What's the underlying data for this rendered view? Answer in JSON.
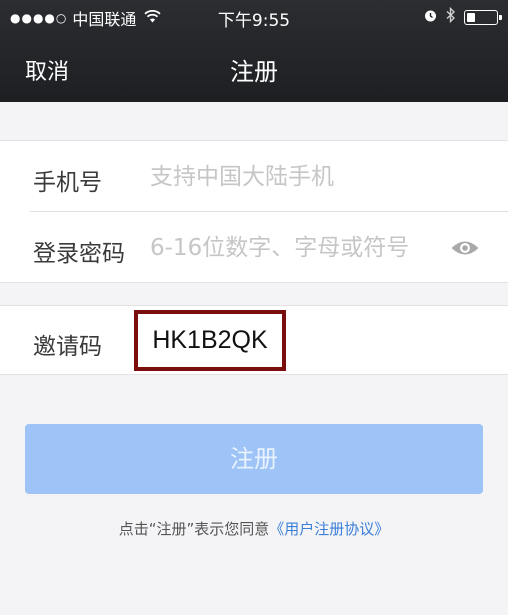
{
  "status_bar": {
    "signal": "●●●●○",
    "carrier": "中国联通",
    "time": "下午9:55"
  },
  "nav": {
    "cancel_label": "取消",
    "title": "注册"
  },
  "form": {
    "phone": {
      "label": "手机号",
      "value": "",
      "placeholder": "支持中国大陆手机"
    },
    "password": {
      "label": "登录密码",
      "value": "",
      "placeholder": "6-16位数字、字母或符号"
    },
    "invite": {
      "label": "邀请码",
      "value": "HK1B2QK"
    }
  },
  "register_button_label": "注册",
  "agreement": {
    "prefix": "点击“注册”表示您同意",
    "link": "《用户注册协议》"
  },
  "colors": {
    "header_bg": "#1d1f22",
    "button_disabled": "#9ec3f7",
    "link": "#3a7fd8",
    "highlight_border": "#7a0e0e"
  },
  "icons": [
    "wifi-icon",
    "alarm-icon",
    "bluetooth-icon",
    "battery-icon",
    "eye-icon"
  ]
}
